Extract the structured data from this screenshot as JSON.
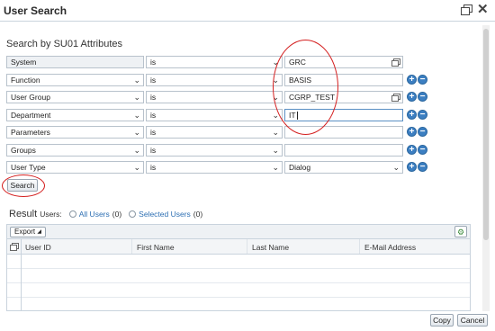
{
  "window": {
    "title": "User Search"
  },
  "search": {
    "section_title": "Search by SU01 Attributes",
    "rows": [
      {
        "attribute": "System",
        "operator": "is",
        "value": "GRC"
      },
      {
        "attribute": "Function",
        "operator": "is",
        "value": "BASIS"
      },
      {
        "attribute": "User Group",
        "operator": "is",
        "value": "CGRP_TEST"
      },
      {
        "attribute": "Department",
        "operator": "is",
        "value": "IT"
      },
      {
        "attribute": "Parameters",
        "operator": "is",
        "value": ""
      },
      {
        "attribute": "Groups",
        "operator": "is",
        "value": ""
      },
      {
        "attribute": "User Type",
        "operator": "is",
        "value": "Dialog"
      }
    ],
    "search_label": "Search"
  },
  "result": {
    "label": "Result",
    "users_label": "Users:",
    "all_users": "All Users",
    "all_count": "(0)",
    "selected_users": "Selected Users",
    "selected_count": "(0)",
    "export_label": "Export",
    "columns": [
      "User ID",
      "First Name",
      "Last Name",
      "E-Mail Address"
    ]
  },
  "footer": {
    "copy_label": "Copy",
    "cancel_label": "Cancel"
  },
  "colors": {
    "accent": "#3c7fc2",
    "annotation": "#d42020"
  }
}
